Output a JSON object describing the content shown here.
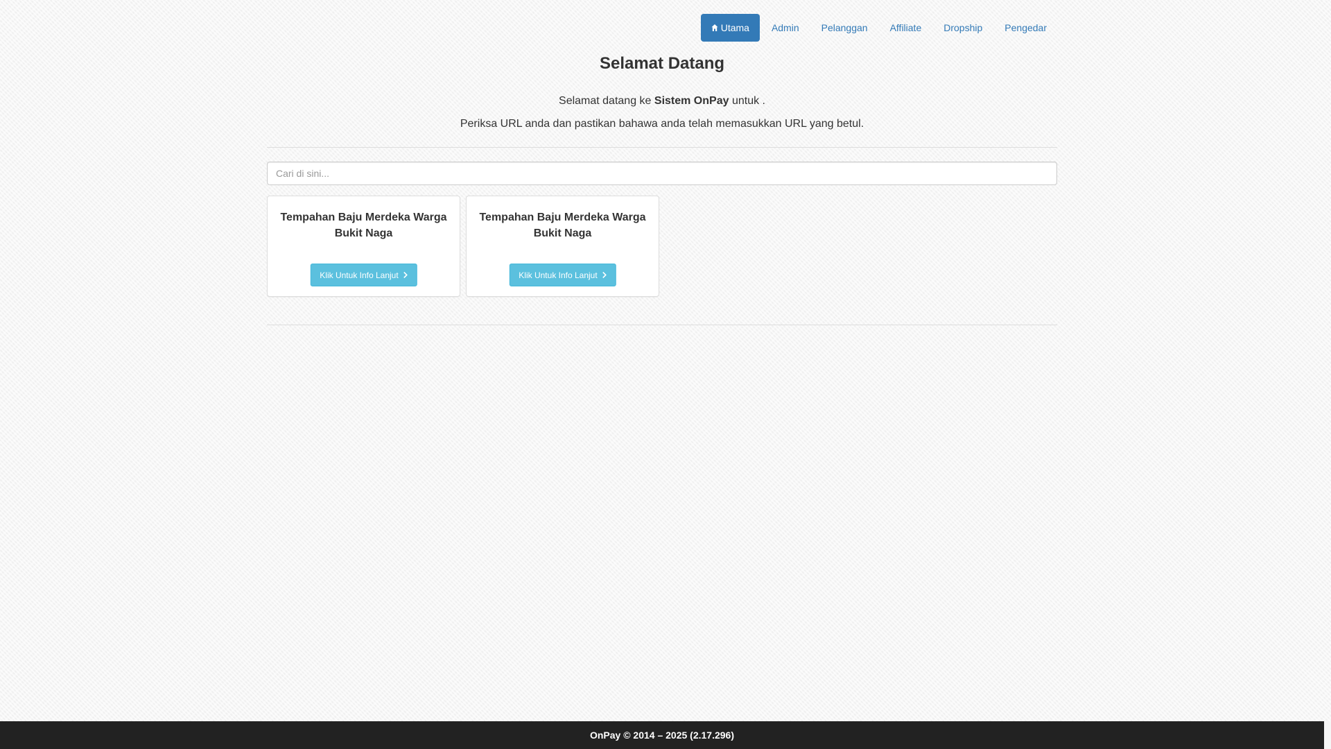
{
  "nav": {
    "items": [
      {
        "label": "Utama",
        "active": true
      },
      {
        "label": "Admin",
        "active": false
      },
      {
        "label": "Pelanggan",
        "active": false
      },
      {
        "label": "Affiliate",
        "active": false
      },
      {
        "label": "Dropship",
        "active": false
      },
      {
        "label": "Pengedar",
        "active": false
      }
    ]
  },
  "header": {
    "title": "Selamat Datang",
    "welcome_prefix": "Selamat datang ke ",
    "welcome_brand": "Sistem OnPay",
    "welcome_suffix": " untuk .",
    "url_note": "Periksa URL anda dan pastikan bahawa anda telah memasukkan URL yang betul."
  },
  "search": {
    "placeholder": "Cari di sini...",
    "value": ""
  },
  "cards": [
    {
      "title": "Tempahan Baju Merdeka Warga Bukit Naga",
      "button_label": "Klik Untuk Info Lanjut"
    },
    {
      "title": "Tempahan Baju Merdeka Warga Bukit Naga",
      "button_label": "Klik Untuk Info Lanjut"
    }
  ],
  "footer": {
    "text": "OnPay © 2014 – 2025 (2.17.296)"
  },
  "colors": {
    "primary": "#337ab7",
    "info": "#5bc0de",
    "footer_bg": "#222222"
  },
  "icons": {
    "nav_active": "home-icon",
    "card_button": "chevron-right-icon"
  }
}
